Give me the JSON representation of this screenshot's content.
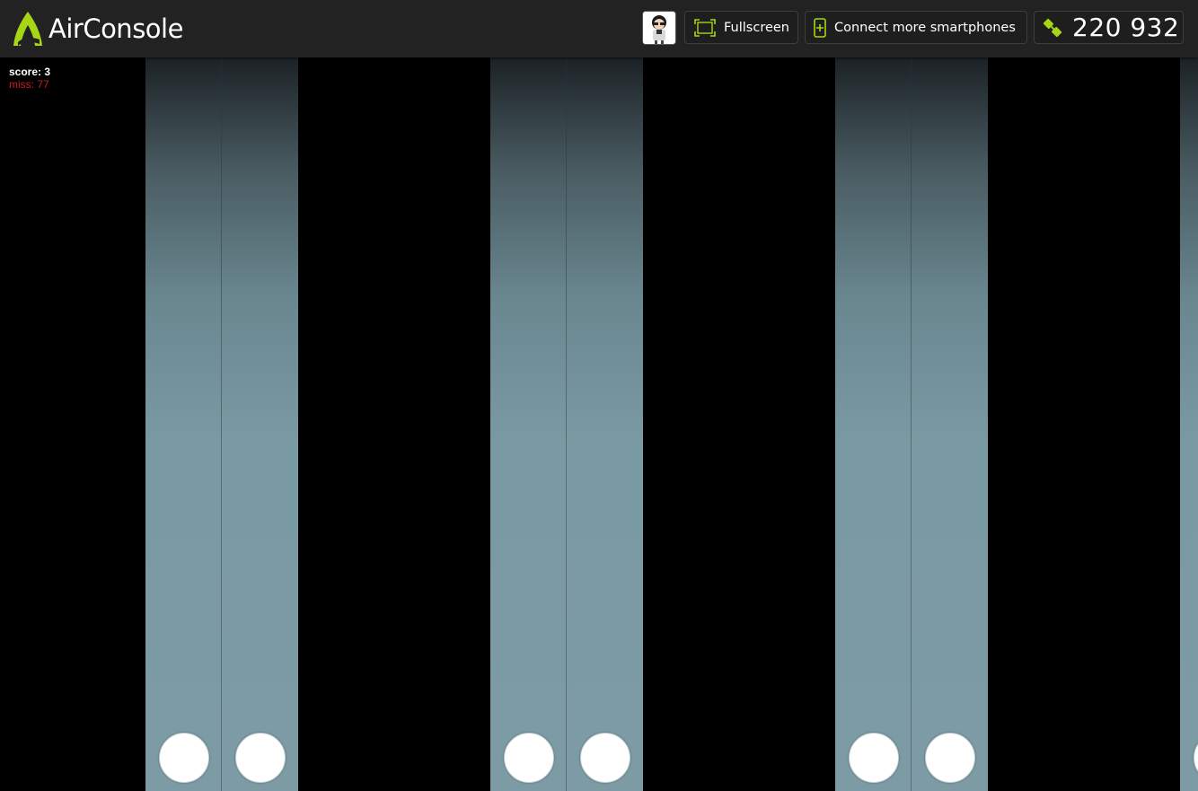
{
  "header": {
    "app_title": "AirConsole",
    "fullscreen_label": "Fullscreen",
    "connect_label": "Connect more smartphones",
    "code": "220 932"
  },
  "game": {
    "score_label": "score: 3",
    "miss_label": "miss: 77"
  },
  "colors": {
    "brand_green": "#a6d615",
    "topbar": "#222222",
    "miss_red": "#cc1a1a",
    "lane": "#7c9ba4"
  },
  "icons": {
    "logo": "airconsole-logo-icon",
    "avatar": "player-avatar",
    "fullscreen": "fullscreen-icon",
    "connect": "smartphone-plus-icon",
    "code": "connection-code-icon"
  }
}
